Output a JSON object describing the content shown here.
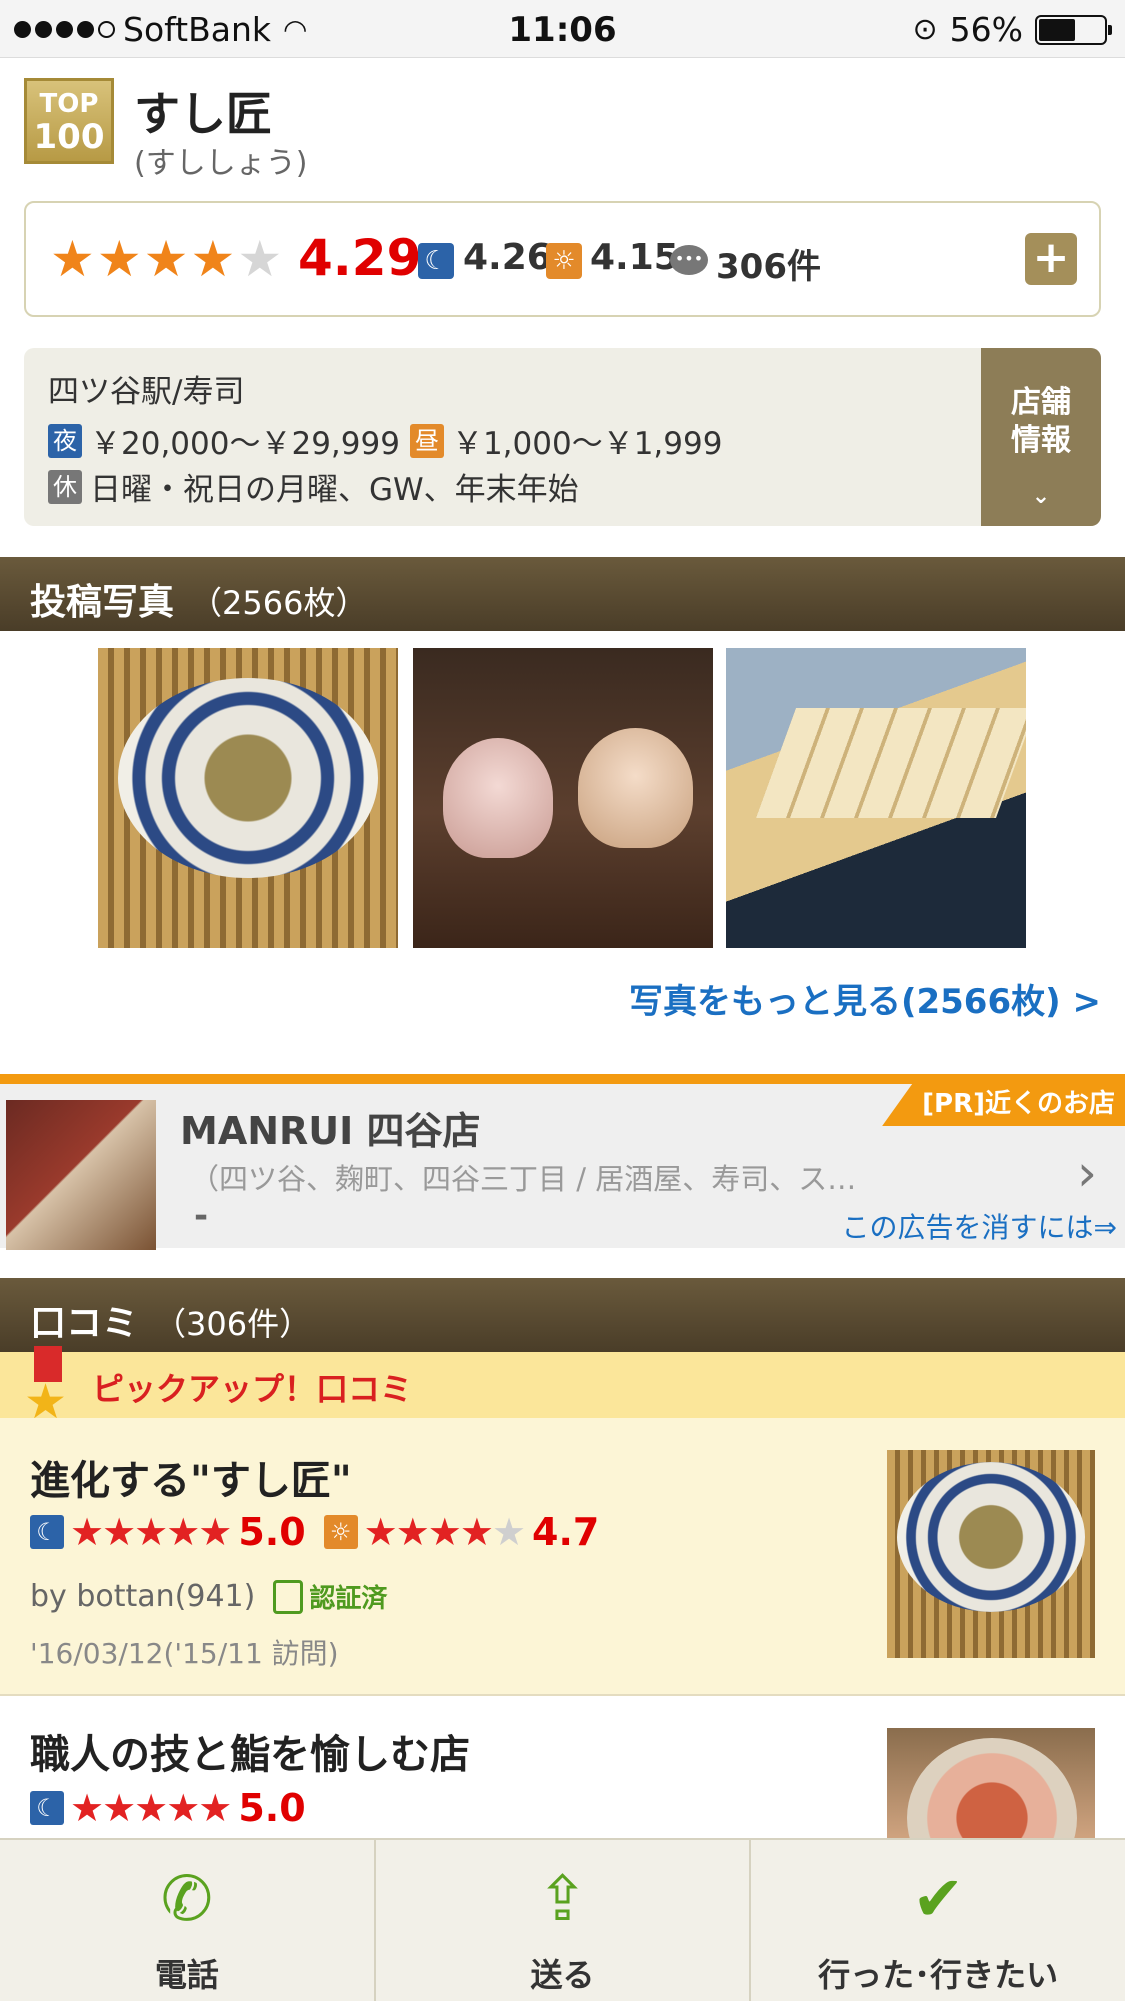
{
  "status_bar": {
    "carrier": "SoftBank",
    "time": "11:06",
    "battery": "56%",
    "battery_level": 0.56
  },
  "shop": {
    "badge_top": "TOP",
    "badge_num": "100",
    "name": "すし匠",
    "kana": "(すししょう)"
  },
  "rating": {
    "score": "4.29",
    "stars": 4.29,
    "night_score": "4.26",
    "day_score": "4.15",
    "review_count": "306件",
    "icon_names": {
      "night": "moon-icon",
      "day": "sun-icon",
      "comment": "comment-icon",
      "expand": "plus-icon"
    }
  },
  "info": {
    "area": "四ツ谷駅/寿司",
    "night_tag": "夜",
    "night_price": "￥20,000～￥29,999",
    "day_tag": "昼",
    "day_price": "￥1,000～￥1,999",
    "holiday_tag": "休",
    "holidays": "日曜・祝日の月曜、GW、年末年始",
    "store_info_button_line1": "店舗",
    "store_info_button_line2": "情報"
  },
  "photos": {
    "header": "投稿写真",
    "count": "（2566枚）",
    "more_link": "写真をもっと見る(2566枚) >"
  },
  "ad": {
    "tag": "[PR]近くのお店",
    "title": "MANRUI 四谷店",
    "subtitle": "（四ツ谷、麹町、四谷三丁目 / 居酒屋、寿司、ス…",
    "dash": "-",
    "remove_link": "この広告を消すには⇒"
  },
  "reviews": {
    "header": "口コミ",
    "count": "（306件）",
    "pickup_label": "ピックアップ！口コミ",
    "items": [
      {
        "title": "進化する\"すし匠\"",
        "night_rating": "5.0",
        "day_rating": "4.7",
        "author": "by bottan(941)",
        "verified": "認証済",
        "date": "'16/03/12('15/11 訪問)"
      },
      {
        "title": "職人の技と鮨を愉しむ店",
        "night_rating": "5.0"
      }
    ]
  },
  "bottom_bar": {
    "call": "電話",
    "send": "送る",
    "want": "行った･行きたい"
  },
  "colors": {
    "score_red": "#e00000",
    "link_blue": "#1a6fc2",
    "header_brown": "#5a4b32",
    "ad_orange": "#f39a10",
    "pickup_yellow": "#fbe69a",
    "action_green": "#5aa21f"
  }
}
